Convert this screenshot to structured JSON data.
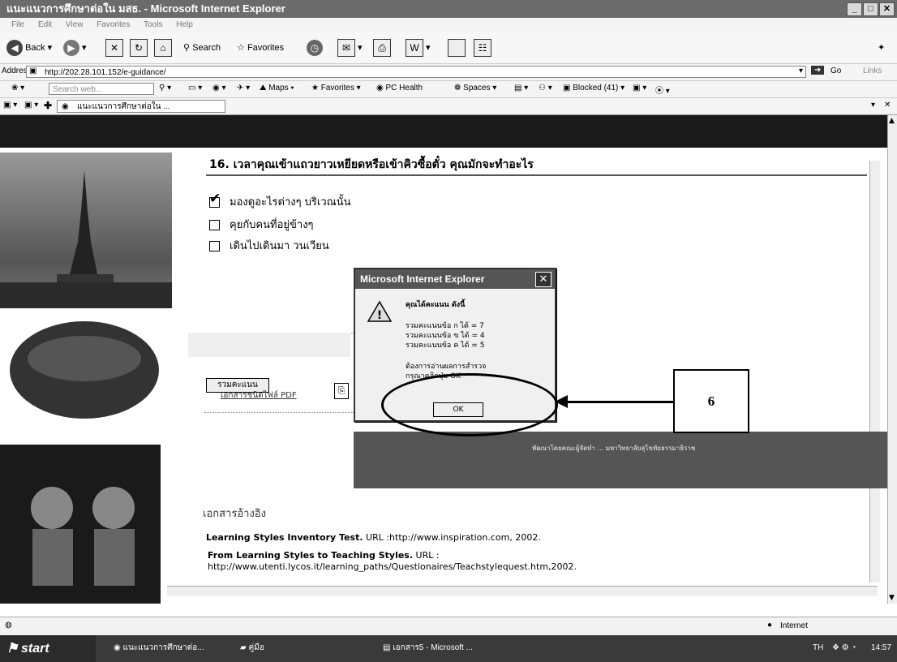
{
  "window": {
    "title": "แนะแนวการศึกษาต่อใน มสธ. - Microsoft Internet Explorer",
    "minimize": "_",
    "maximize": "□",
    "close": "✕"
  },
  "menu": [
    "File",
    "Edit",
    "View",
    "Favorites",
    "Tools",
    "Help"
  ],
  "toolbar": {
    "back": "Back",
    "search": "Search",
    "favorites": "Favorites"
  },
  "address": {
    "label": "Address",
    "url": "http://202.28.101.152/e-guidance/",
    "go": "Go",
    "links": "Links"
  },
  "searchbar": {
    "placeholder": "Search web...",
    "maps": "Maps",
    "favorites": "Favorites",
    "pc_health": "PC Health",
    "spaces": "Spaces",
    "blocked": "Blocked (41)"
  },
  "tab": {
    "title": "แนะแนวการศึกษาต่อใน ..."
  },
  "page": {
    "question": "16. เวลาคุณเข้าแถวยาวเหยียดหรือเข้าคิวซื้อตั๋ว คุณมักจะทำอะไร",
    "options": [
      {
        "label": "มองดูอะไรต่างๆ บริเวณนั้น",
        "checked": true
      },
      {
        "label": "คุยกับคนที่อยู่ข้างๆ",
        "checked": false
      },
      {
        "label": "เดินไปเดินมา วนเวียน",
        "checked": false
      }
    ],
    "total_button": "รวมคะแนน",
    "pdf_link": "เอกสารชนิดไฟล์ PDF",
    "references_heading": "เอกสารอ้างอิง",
    "references": [
      {
        "title": "Learning Styles Inventory Test.",
        "rest": " URL :http://www.inspiration.com, 2002."
      },
      {
        "title": "From Learning Styles to Teaching Styles.",
        "rest": " URL :"
      }
    ],
    "reference_url_line": "http://www.utenti.lycos.it/learning_paths/Questionaires/Teachstylequest.htm,2002.",
    "footer_text": "พัฒนาโดยคณะผู้จัดทำ ... มหาวิทยาลัยสุโขทัยธรรมาธิราช"
  },
  "dialog": {
    "title": "Microsoft Internet Explorer",
    "close": "✕",
    "heading": "คุณได้คะแนน ดังนี้",
    "lines": [
      "รวมคะแนนข้อ ก   ได้ = 7",
      "รวมคะแนนข้อ ข   ได้ = 4",
      "รวมคะแนนข้อ ค   ได้ = 5"
    ],
    "prompt1": "ต้องการอ่านผลการสำรวจ",
    "prompt2": "กรุณาคลิกปุ่ม OK",
    "ok": "OK",
    "warning_icon": "!"
  },
  "annotation": {
    "callout": "6"
  },
  "statusbar": {
    "zone": "Internet"
  },
  "taskbar": {
    "start": "start",
    "tasks": [
      "แนะแนวการศึกษาต่อ...",
      "คู่มือ",
      "เอกสาร5 - Microsoft ..."
    ],
    "lang": "TH",
    "time": "14:57"
  }
}
